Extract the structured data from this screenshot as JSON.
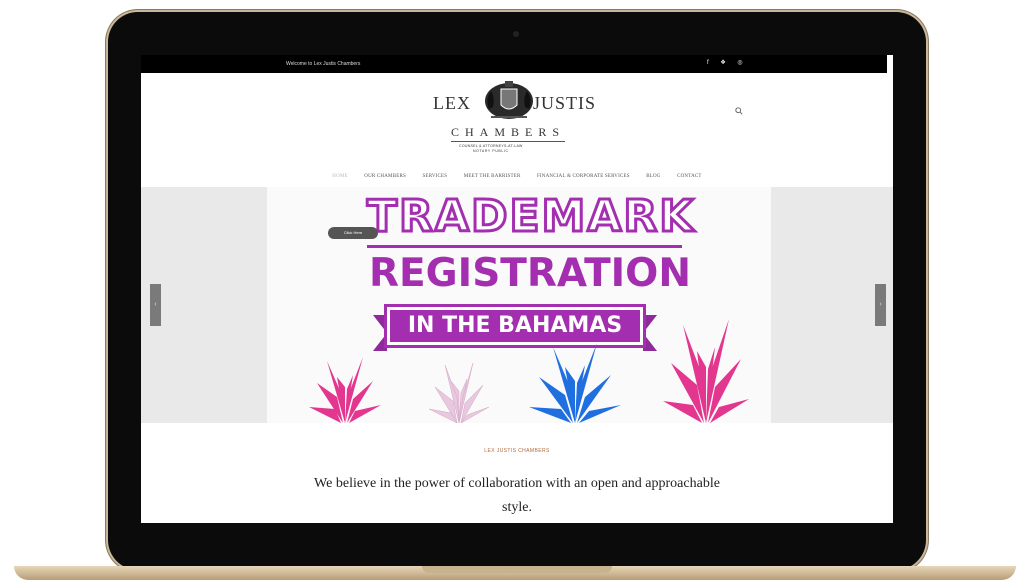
{
  "topbar": {
    "welcome": "Welcome to Lex Justis Chambers",
    "social_icons": [
      "facebook-icon",
      "twitter-icon",
      "instagram-icon"
    ],
    "social_glyphs": "f ❖ ◎"
  },
  "logo": {
    "lex": "LEX",
    "justis": "JUSTIS",
    "chambers": "CHAMBERS",
    "sub1": "COUNSEL & ATTORNEYS-AT-LAW",
    "sub2": "NOTARY PUBLIC"
  },
  "nav": {
    "items": [
      {
        "label": "HOME",
        "active": true
      },
      {
        "label": "OUR CHAMBERS"
      },
      {
        "label": "SERVICES"
      },
      {
        "label": "MEET THE BARRISTER"
      },
      {
        "label": "FINANCIAL & CORPORATE SERVICES"
      },
      {
        "label": "BLOG"
      },
      {
        "label": "CONTACT"
      }
    ]
  },
  "hero": {
    "button": "Click Here",
    "title1": "TRADEMARK",
    "title2": "REGISTRATION",
    "ribbon": "IN THE BAHAMAS",
    "prev": "‹",
    "next": "›"
  },
  "content": {
    "kicker": "LEX JUSTIS CHAMBERS",
    "tagline": "We believe in the power of collaboration with an open and approachable style."
  },
  "colors": {
    "brand_purple": "#a32fb0",
    "pineapple_pink": "#e2368f",
    "pineapple_blue": "#1f6fe0",
    "pineapple_light": "#e8c8df"
  }
}
